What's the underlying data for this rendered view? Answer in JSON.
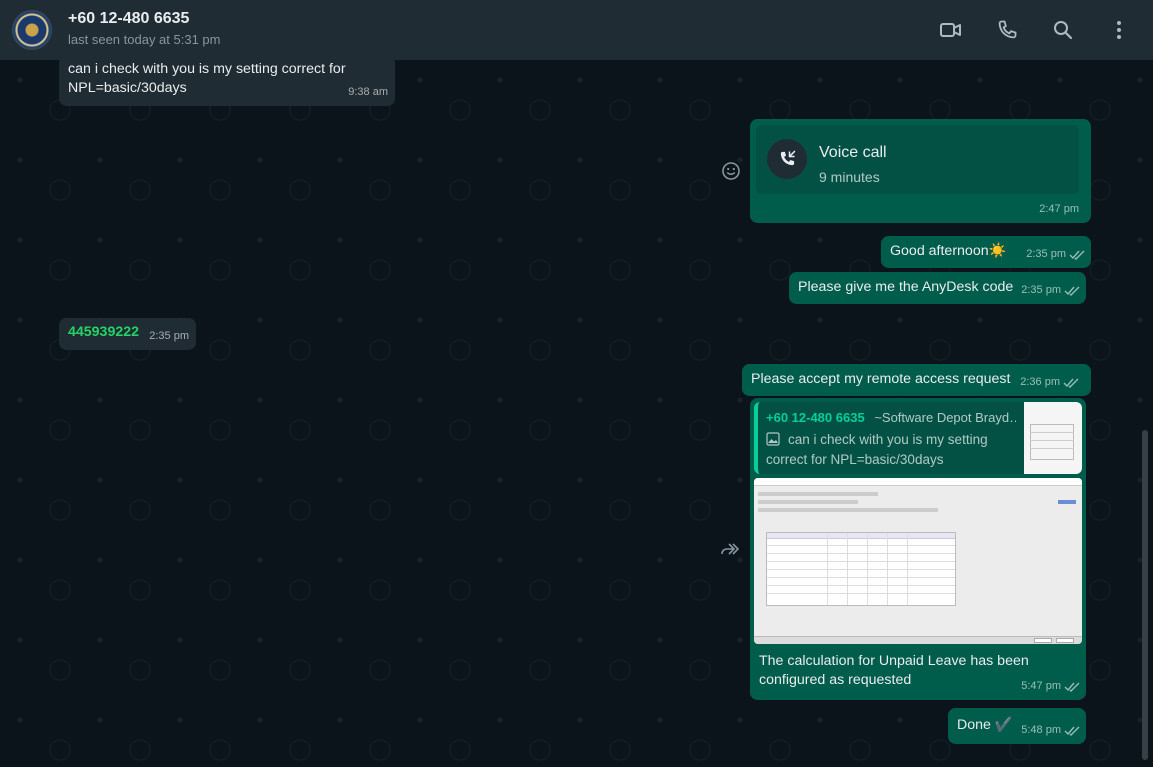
{
  "header": {
    "contact_name": "+60 12-480 6635",
    "last_seen": "last seen today at 5:31 pm",
    "icons": [
      "video-call-icon",
      "voice-call-icon",
      "search-icon",
      "menu-dots-icon"
    ]
  },
  "messages": {
    "m1": {
      "text": "can i check with you is my setting correct for NPL=basic/30days",
      "time": "9:38 am"
    },
    "m2": {
      "title": "Voice call",
      "duration": "9 minutes",
      "time": "2:47 pm"
    },
    "m3": {
      "text": "Good afternoon",
      "emoji": "☀️",
      "time": "2:35 pm"
    },
    "m4": {
      "text": "Please give me the AnyDesk code",
      "time": "2:35 pm"
    },
    "m5": {
      "text": "445939222",
      "time": "2:35 pm"
    },
    "m6": {
      "text": "Please accept my remote access request",
      "time": "2:36 pm"
    },
    "m7": {
      "quote_author": "+60 12-480 6635",
      "quote_group": "~Software Depot Brayd…",
      "quote_text": "can i check with you is my setting correct for NPL=basic/30days",
      "text": "The calculation for Unpaid Leave has been configured as requested",
      "time": "5:47 pm"
    },
    "m8": {
      "text": "Done",
      "emoji": "✔️",
      "time": "5:48 pm"
    }
  },
  "colors": {
    "incoming": "#202c33",
    "outgoing": "#005c4b",
    "accent": "#06cf9c",
    "link": "#25d366"
  }
}
